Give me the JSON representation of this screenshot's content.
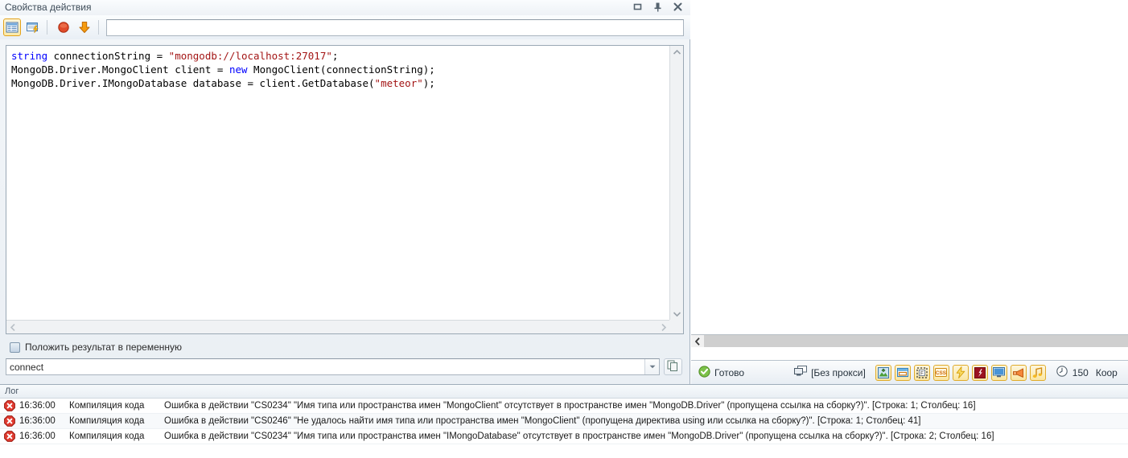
{
  "window": {
    "title": "Свойства действия",
    "buttons": [
      {
        "name": "maximize",
        "icon": "maximize-icon"
      },
      {
        "name": "pin",
        "icon": "pin-icon"
      },
      {
        "name": "close",
        "icon": "close-icon"
      }
    ]
  },
  "toolbar": {
    "buttons": [
      {
        "name": "list-view",
        "icon": "list-table-icon",
        "active": true
      },
      {
        "name": "script-window",
        "icon": "window-lightning-icon",
        "active": false
      },
      {
        "name": "stop",
        "icon": "red-circle-icon",
        "active": false
      },
      {
        "name": "download",
        "icon": "orange-down-arrow-icon",
        "active": false
      }
    ],
    "input_value": "",
    "input_placeholder": ""
  },
  "editor": {
    "lines": [
      [
        {
          "t": "string",
          "c": "kw"
        },
        {
          "t": " connectionString = ",
          "c": ""
        },
        {
          "t": "\"mongodb://localhost:27017\"",
          "c": "str"
        },
        {
          "t": ";",
          "c": ""
        }
      ],
      [
        {
          "t": "MongoDB.Driver.MongoClient client = ",
          "c": ""
        },
        {
          "t": "new",
          "c": "kw"
        },
        {
          "t": " MongoClient(connectionString);",
          "c": ""
        }
      ],
      [
        {
          "t": "MongoDB.Driver.IMongoDatabase database = client.GetDatabase(",
          "c": ""
        },
        {
          "t": "\"meteor\"",
          "c": "str"
        },
        {
          "t": ");",
          "c": ""
        }
      ]
    ],
    "scroll_up": "▲",
    "scroll_down": "▼",
    "scroll_left": "◄",
    "scroll_right": "►"
  },
  "result": {
    "checkbox_label": "Положить результат в переменную",
    "checkbox_checked": false,
    "variable_value": "connect",
    "dropdown_arrow": "▼",
    "copy_button_name": "copy-icon"
  },
  "right_panel": {
    "hscroll_left_arrow": "❮"
  },
  "statusbar": {
    "status_icon": "check-circle-icon",
    "status_text": "Готово",
    "proxy_icon": "monitor-icon",
    "proxy_text": "[Без прокси]",
    "icons": [
      {
        "name": "image-icon",
        "glyph": "image"
      },
      {
        "name": "window-icon",
        "glyph": "window"
      },
      {
        "name": "frame-icon",
        "glyph": "frame"
      },
      {
        "name": "css-icon",
        "glyph": "css"
      },
      {
        "name": "lightning-icon",
        "glyph": "lightning"
      },
      {
        "name": "flash-icon",
        "glyph": "flash"
      },
      {
        "name": "screen-icon",
        "glyph": "screen"
      },
      {
        "name": "megaphone-icon",
        "glyph": "megaphone"
      },
      {
        "name": "music-icon",
        "glyph": "music"
      }
    ],
    "clock_icon": "clock-icon",
    "clock_value": "150",
    "coord_text": "Коор"
  },
  "log": {
    "title": "Лог",
    "columns": [
      "",
      "time",
      "source",
      "message"
    ],
    "rows": [
      {
        "icon": "error-icon",
        "time": "16:36:00",
        "source": "Компиляция кода",
        "message": "Ошибка в действии \"CS0234\" \"Имя типа или пространства имен \"MongoClient\" отсутствует в пространстве имен \"MongoDB.Driver\" (пропущена ссылка на сборку?)\". [Строка: 1; Столбец: 16]"
      },
      {
        "icon": "error-icon",
        "time": "16:36:00",
        "source": "Компиляция кода",
        "message": "Ошибка в действии \"CS0246\" \"Не удалось найти имя типа или пространства имен \"MongoClient\" (пропущена директива using или ссылка на сборку?)\". [Строка: 1; Столбец: 41]"
      },
      {
        "icon": "error-icon",
        "time": "16:36:00",
        "source": "Компиляция кода",
        "message": "Ошибка в действии \"CS0234\" \"Имя типа или пространства имен \"IMongoDatabase\" отсутствует в пространстве имен \"MongoDB.Driver\" (пропущена ссылка на сборку?)\". [Строка: 2; Столбец: 16]"
      }
    ]
  },
  "colors": {
    "accent": "#e3a21a",
    "error": "#d32f2f",
    "ok": "#5a9e2f",
    "keyword": "#0000ff",
    "string": "#a31515"
  }
}
